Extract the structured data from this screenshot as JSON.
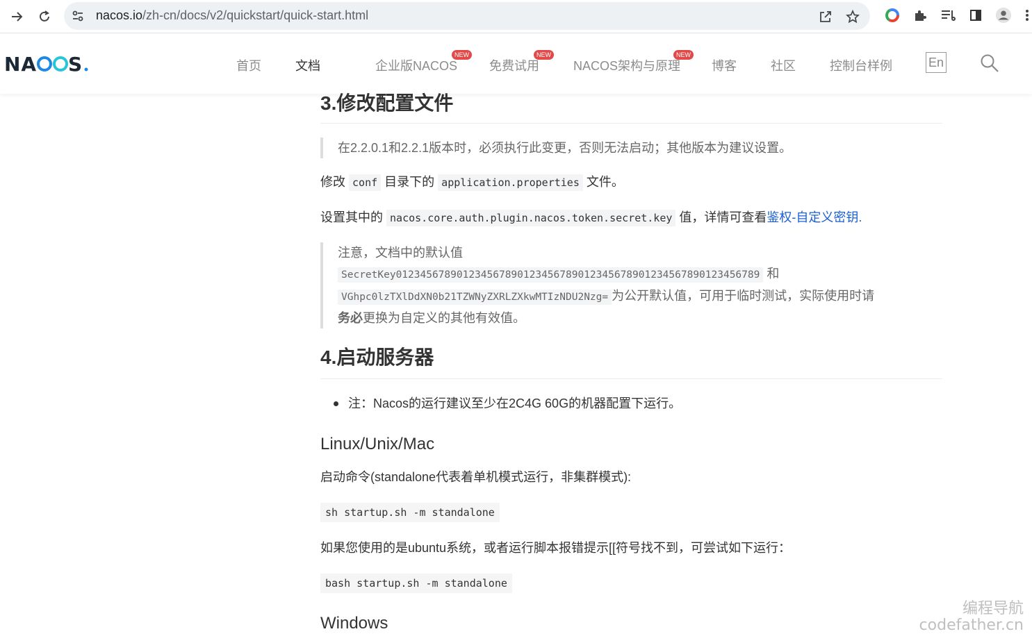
{
  "browser": {
    "url_host": "nacos.io",
    "url_path": "/zh-cn/docs/v2/quickstart/quick-start.html"
  },
  "header": {
    "logo_text": "NACOS.",
    "nav": [
      {
        "label": "首页"
      },
      {
        "label": "文档"
      },
      {
        "label": "企业版NACOS",
        "badge": "NEW"
      },
      {
        "label": "免费试用",
        "badge": "NEW"
      },
      {
        "label": "NACOS架构与原理",
        "badge": "NEW"
      },
      {
        "label": "博客"
      },
      {
        "label": "社区"
      },
      {
        "label": "控制台样例"
      }
    ],
    "lang": "En"
  },
  "content": {
    "s3_title": "3.修改配置文件",
    "s3_quote": "在2.2.0.1和2.2.1版本时，必须执行此变更，否则无法启动；其他版本为建议设置。",
    "p1_a": "修改",
    "p1_code1": "conf",
    "p1_b": "目录下的",
    "p1_code2": "application.properties",
    "p1_c": "文件。",
    "p2_a": "设置其中的",
    "p2_code": "nacos.core.auth.plugin.nacos.token.secret.key",
    "p2_b": "值，详情可查看",
    "p2_link": "鉴权-自定义密钥",
    "p2_c": ".",
    "note_line1": "注意，文档中的默认值",
    "note_code1": "SecretKey012345678901234567890123456789012345678901234567890123456789",
    "note_and": "和",
    "note_code2": "VGhpc0lzTXlDdXN0b21TZWNyZXRLZXkwMTIzNDU2Nzg=",
    "note_tail": "为公开默认值，可用于临时测试，实际使用时请",
    "note_bold": "务必",
    "note_end": "更换为自定义的其他有效值。",
    "s4_title": "4.启动服务器",
    "bullet1": "注：Nacos的运行建议至少在2C4G 60G的机器配置下运行。",
    "linux_title": "Linux/Unix/Mac",
    "linux_desc": "启动命令(standalone代表着单机模式运行，非集群模式):",
    "cmd1": "sh startup.sh -m standalone",
    "ubuntu_desc": "如果您使用的是ubuntu系统，或者运行脚本报错提示[[符号找不到，可尝试如下运行：",
    "cmd2": "bash startup.sh -m standalone",
    "windows_title": "Windows"
  },
  "watermark": {
    "line1": "编程导航",
    "line2": "codefather.cn"
  }
}
